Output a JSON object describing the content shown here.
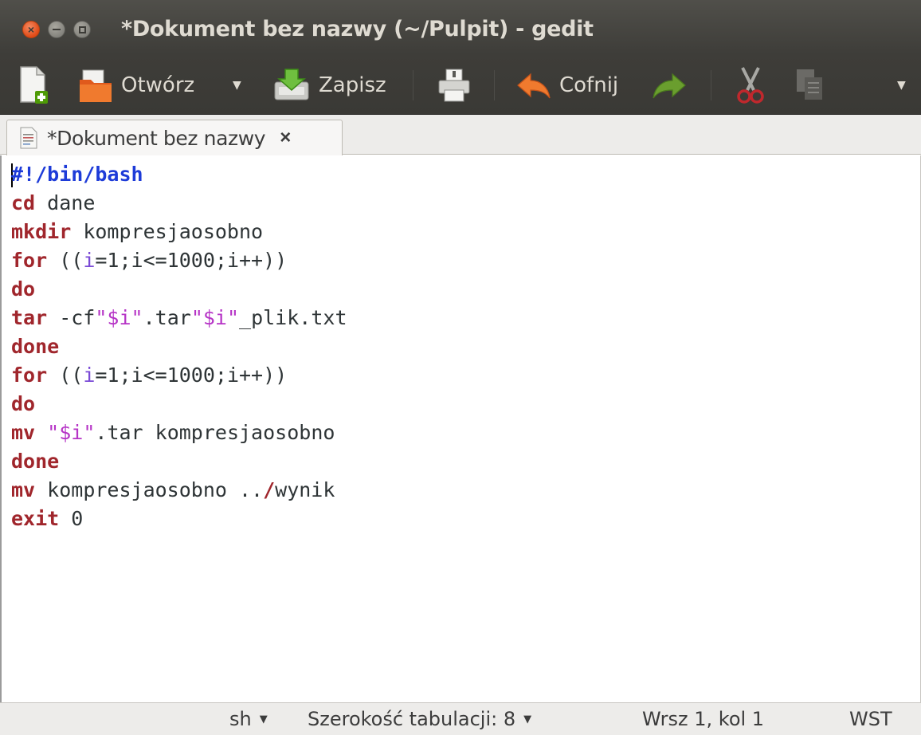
{
  "window": {
    "title": "*Dokument bez nazwy (~/Pulpit) - gedit"
  },
  "toolbar": {
    "new_icon": "new-document-icon",
    "open_label": "Otwórz",
    "save_label": "Zapisz",
    "print_icon": "print-icon",
    "undo_label": "Cofnij",
    "redo_icon": "redo-icon",
    "cut_icon": "cut-icon",
    "copy_icon": "copy-icon"
  },
  "tabs": [
    {
      "label": "*Dokument bez nazwy",
      "close": "×"
    }
  ],
  "editor": {
    "lines": [
      "#!/bin/bash",
      "cd dane",
      "mkdir kompresjaosobno",
      "for ((i=1;i<=1000;i++))",
      "do",
      "tar -cf\"$i\".tar\"$i\"_plik.txt",
      "done",
      "for ((i=1;i<=1000;i++))",
      "do",
      "mv \"$i\".tar kompresjaosobno",
      "done",
      "mv kompresjaosobno ../wynik",
      "exit 0"
    ]
  },
  "statusbar": {
    "language": "sh",
    "tab_width": "Szerokość tabulacji: 8",
    "position": "Wrsz 1, kol 1",
    "mode": "WST"
  }
}
